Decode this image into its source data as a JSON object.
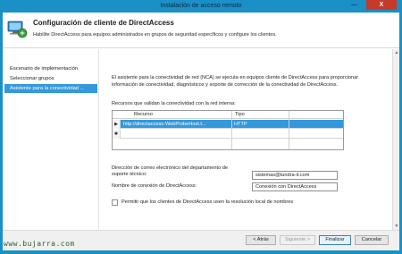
{
  "window": {
    "title": "Instalación de acceso remoto",
    "minimize_glyph": "—",
    "close_glyph": "X"
  },
  "header": {
    "title": "Configuración de cliente de DirectAccess",
    "subtitle": "Habilite DirectAccess para equipos administrados en grupos de seguridad específicos y configure los clientes.",
    "icon": "directaccess-computer-icon"
  },
  "nav": {
    "items": [
      {
        "label": "Escenario de implementación",
        "active": false
      },
      {
        "label": "Seleccionar grupos",
        "active": false
      },
      {
        "label": "Asistente para la conectividad ...",
        "active": true
      }
    ]
  },
  "content": {
    "intro": "El asistente para la conectividad de red (NCA) se ejecuta en equipos cliente de DirectAccess para proporcionar información de conectividad, diagnósticos y soporte de corrección de la conectividad de DirectAccess.",
    "resources_label": "Recursos que validan la conectividad con la red interna:",
    "grid": {
      "columns": [
        "Recurso",
        "Tipo"
      ],
      "rows": [
        {
          "marker": "▶",
          "resource": "http://directaccess-WebProbeHost.t...",
          "type": "HTTP",
          "selected": true
        },
        {
          "marker": "✱",
          "resource": "",
          "type": "",
          "selected": false
        }
      ]
    },
    "email_label": "Dirección de correo electrónico del departamento de soporte técnico:",
    "email_value": "sistemas@tundra-it.com",
    "connection_label": "Nombre de conexión de DirectAccess:",
    "connection_value": "Conexión con DirectAccess",
    "local_resolution_label": "Permitir que los clientes de DirectAccess usen la resolución local de nombres",
    "local_resolution_checked": false
  },
  "footer": {
    "back": "< Atrás",
    "next": "Siguiente >",
    "finish": "Finalizar",
    "cancel": "Cancelar"
  },
  "watermark": "www.bujarra.com",
  "colors": {
    "frame": "#1a90c7",
    "selection": "#3398dc",
    "close": "#c7392b"
  }
}
